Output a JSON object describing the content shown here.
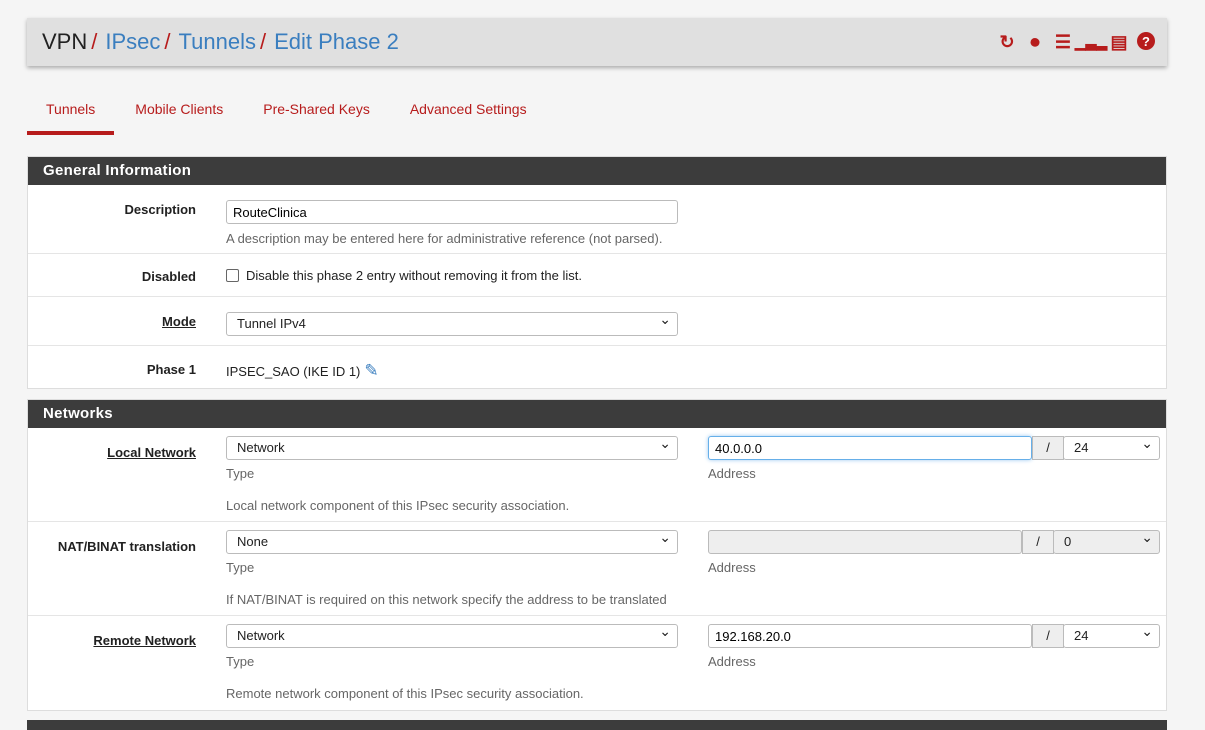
{
  "breadcrumb": {
    "items": [
      "VPN",
      "IPsec",
      "Tunnels",
      "Edit Phase 2"
    ]
  },
  "header_icons": [
    "reload-icon",
    "stop-icon",
    "sliders-icon",
    "bar-chart-icon",
    "list-icon",
    "help-icon"
  ],
  "tabs": [
    {
      "label": "Tunnels",
      "active": true
    },
    {
      "label": "Mobile Clients"
    },
    {
      "label": "Pre-Shared Keys"
    },
    {
      "label": "Advanced Settings"
    }
  ],
  "general": {
    "title": "General Information",
    "description": {
      "label": "Description",
      "value": "RouteClinica",
      "help": "A description may be entered here for administrative reference (not parsed)."
    },
    "disabled": {
      "label": "Disabled",
      "text": "Disable this phase 2 entry without removing it from the list.",
      "checked": false
    },
    "mode": {
      "label": "Mode",
      "value": "Tunnel IPv4"
    },
    "phase1": {
      "label": "Phase 1",
      "value": "IPSEC_SAO (IKE ID 1)"
    }
  },
  "networks": {
    "title": "Networks",
    "local": {
      "label": "Local Network",
      "type": "Network",
      "type_label": "Type",
      "address": "40.0.0.0",
      "address_label": "Address",
      "mask": "24",
      "help": "Local network component of this IPsec security association."
    },
    "nat": {
      "label": "NAT/BINAT translation",
      "type": "None",
      "type_label": "Type",
      "address": "",
      "address_label": "Address",
      "mask": "0",
      "help": "If NAT/BINAT is required on this network specify the address to be translated"
    },
    "remote": {
      "label": "Remote Network",
      "type": "Network",
      "type_label": "Type",
      "address": "192.168.20.0",
      "address_label": "Address",
      "mask": "24",
      "help": "Remote network component of this IPsec security association."
    }
  },
  "slash": "/",
  "colors": {
    "accent": "#b71c1c",
    "link": "#3a7ebf",
    "panel_header": "#3c3c3c"
  }
}
